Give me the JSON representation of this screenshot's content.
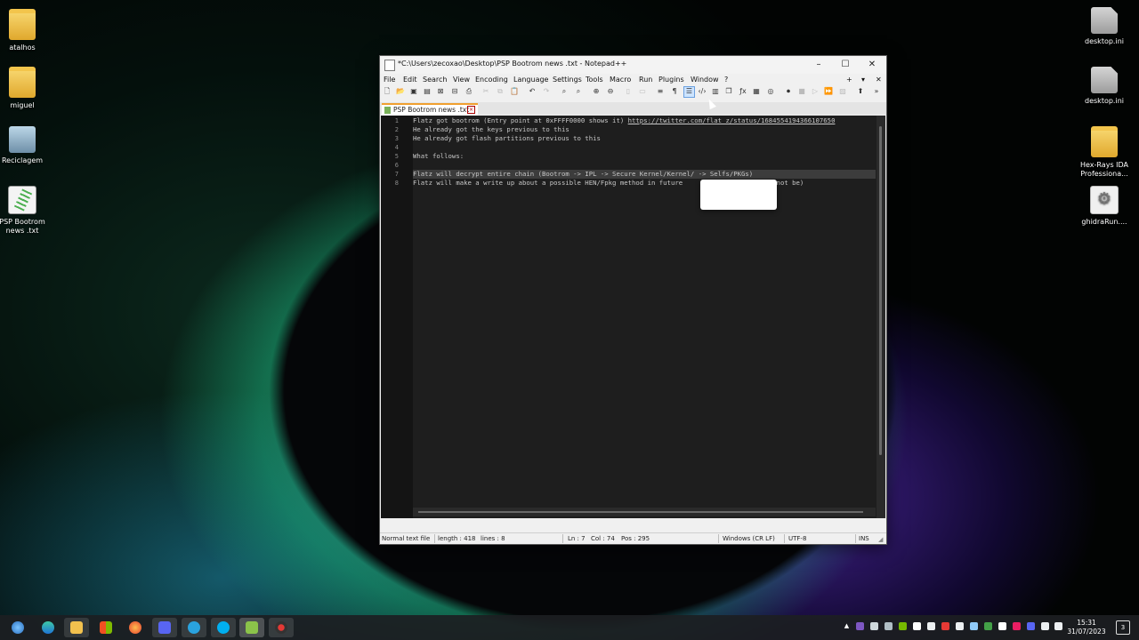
{
  "desktop": {
    "left_icons": [
      {
        "label": "atalhos"
      },
      {
        "label": "miguel"
      },
      {
        "label": "Reciclagem"
      },
      {
        "label": "PSP Bootrom news .txt"
      }
    ],
    "right_icons": [
      {
        "label": "desktop.ini"
      },
      {
        "label": "desktop.ini"
      },
      {
        "label": "Hex-Rays IDA Professiona..."
      },
      {
        "label": "ghidraRun...."
      }
    ]
  },
  "window": {
    "title": "*C:\\Users\\zecoxao\\Desktop\\PSP Bootrom news .txt - Notepad++",
    "controls": {
      "minimize": "–",
      "maximize": "☐",
      "close": "✕"
    },
    "menu": [
      "File",
      "Edit",
      "Search",
      "View",
      "Encoding",
      "Language",
      "Settings",
      "Tools",
      "Macro",
      "Run",
      "Plugins",
      "Window",
      "?"
    ],
    "menu_right": {
      "plus": "+",
      "down": "▾",
      "close": "✕"
    },
    "tab": {
      "label": "PSP Bootrom news .txt",
      "close": "×"
    },
    "lines": [
      {
        "num": "1",
        "text": "Flatz got bootrom (Entry point at 0xFFFF0000 shows it) ",
        "link": "https://twitter.com/flat_z/status/1684554194366107650"
      },
      {
        "num": "2",
        "text": "He already got the keys previous to this",
        "link": ""
      },
      {
        "num": "3",
        "text": "He already got flash partitions previous to this",
        "link": ""
      },
      {
        "num": "4",
        "text": "",
        "link": ""
      },
      {
        "num": "5",
        "text": "What follows:",
        "link": ""
      },
      {
        "num": "6",
        "text": "",
        "link": ""
      },
      {
        "num": "7",
        "text": "Flatz will decrypt entire chain (Bootrom -> IPL -> Secure Kernel/Kernel/ -> Selfs/PKGs)",
        "link": ""
      },
      {
        "num": "8",
        "text": "Flatz will make a write up about a possible HEN/Fpkg method in future            e (it might not be)",
        "link": ""
      }
    ],
    "status": {
      "file_type": "Normal text file",
      "length": "length : 418",
      "lines": "lines : 8",
      "ln": "Ln : 7",
      "col": "Col : 74",
      "pos": "Pos : 295",
      "eol": "Windows (CR LF)",
      "encoding": "UTF-8",
      "mode": "INS"
    }
  },
  "taskbar": {
    "time": "15:31",
    "date": "31/07/2023",
    "notification_count": "3"
  },
  "colors": {
    "editor_bg": "#2f2f2f",
    "gutter_bg": "#141414",
    "text": "#c8c8c8",
    "tab_accent": "#f0a030"
  }
}
